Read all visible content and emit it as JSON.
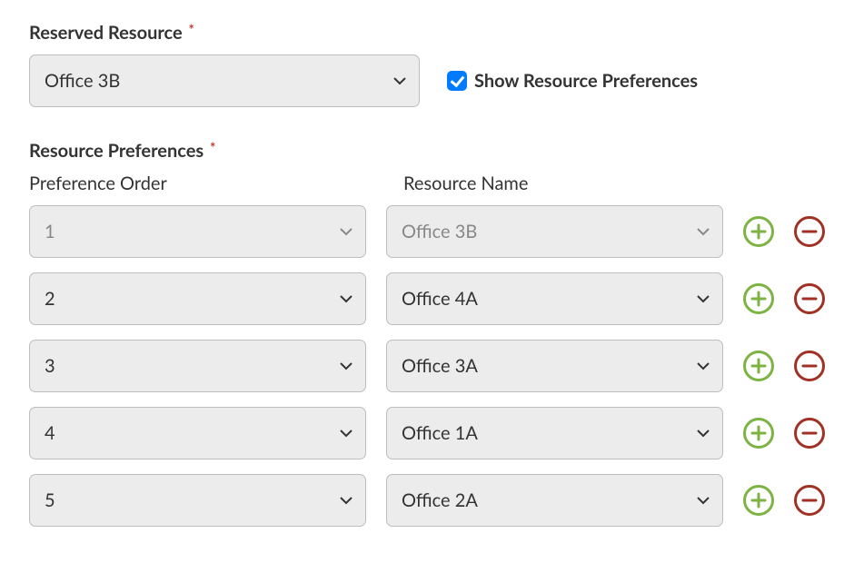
{
  "reserved": {
    "label": "Reserved Resource",
    "value": "Office 3B"
  },
  "show_preferences": {
    "label": "Show Resource Preferences",
    "checked": true
  },
  "preferences": {
    "label": "Resource Preferences",
    "col_order": "Preference Order",
    "col_name": "Resource Name",
    "rows": [
      {
        "order": "1",
        "name": "Office 3B",
        "disabled": true
      },
      {
        "order": "2",
        "name": "Office 4A",
        "disabled": false
      },
      {
        "order": "3",
        "name": "Office 3A",
        "disabled": false
      },
      {
        "order": "4",
        "name": "Office 1A",
        "disabled": false
      },
      {
        "order": "5",
        "name": "Office 2A",
        "disabled": false
      }
    ]
  }
}
